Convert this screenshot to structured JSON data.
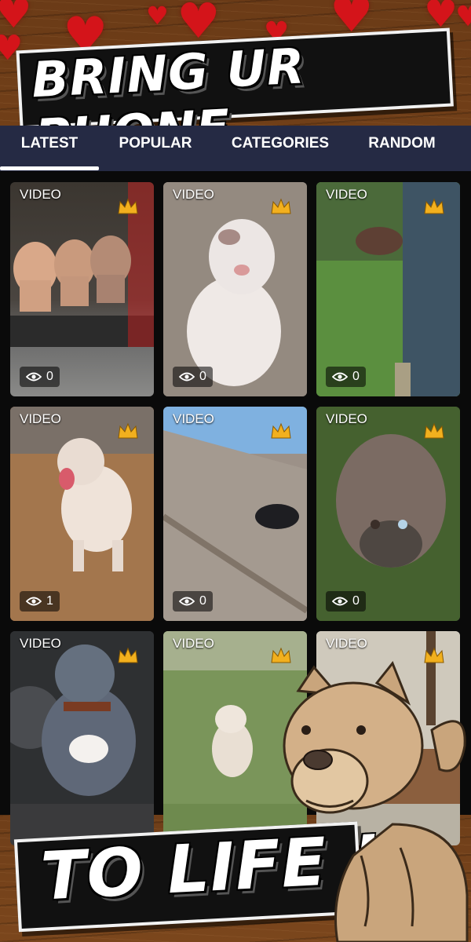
{
  "header": {
    "title": "BRING UR PHONE"
  },
  "tabs": [
    {
      "label": "LATEST",
      "active": true
    },
    {
      "label": "POPULAR",
      "active": false
    },
    {
      "label": "CATEGORIES",
      "active": false
    },
    {
      "label": "RANDOM",
      "active": false
    }
  ],
  "cards": [
    {
      "badge": "VIDEO",
      "views": "0",
      "premium": true
    },
    {
      "badge": "VIDEO",
      "views": "0",
      "premium": true
    },
    {
      "badge": "VIDEO",
      "views": "0",
      "premium": true
    },
    {
      "badge": "VIDEO",
      "views": "1",
      "premium": true
    },
    {
      "badge": "VIDEO",
      "views": "0",
      "premium": true
    },
    {
      "badge": "VIDEO",
      "views": "0",
      "premium": true
    },
    {
      "badge": "VIDEO",
      "views": "",
      "premium": true
    },
    {
      "badge": "VIDEO",
      "views": "",
      "premium": true
    },
    {
      "badge": "VIDEO",
      "views": "",
      "premium": true
    }
  ],
  "footer": {
    "title": "TO LIFE !"
  },
  "colors": {
    "tabbar": "#252a44",
    "crown": "#f2b01e",
    "heart": "#d4141a"
  },
  "icons": {
    "views": "eye-icon",
    "premium": "crown-icon",
    "decor": "heart-icon"
  }
}
